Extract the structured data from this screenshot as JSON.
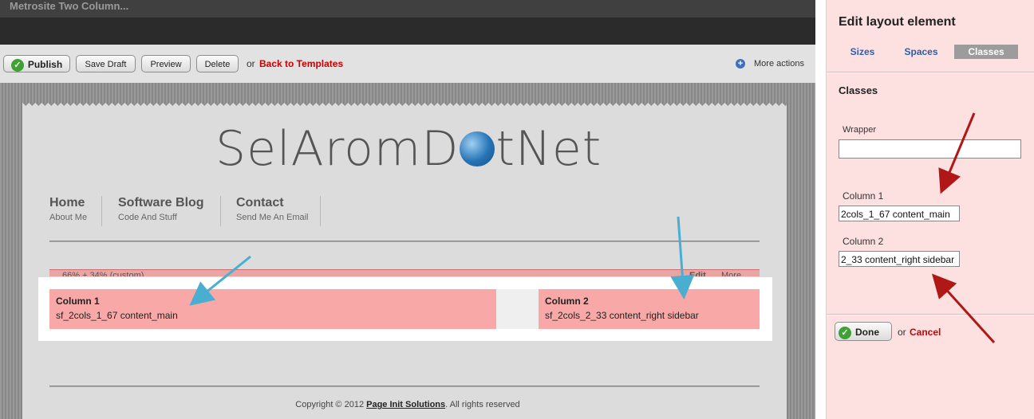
{
  "window": {
    "title": "Metrosite Two Column..."
  },
  "toolbar": {
    "publish_label": "Publish",
    "save_draft_label": "Save Draft",
    "preview_label": "Preview",
    "delete_label": "Delete",
    "or_text": "or",
    "back_link": "Back to Templates",
    "more_actions_label": "More actions"
  },
  "site": {
    "logo_text_left": "SelArom",
    "logo_text_mid": "D",
    "logo_text_right": "tNet",
    "nav": [
      {
        "title": "Home",
        "sub": "About Me"
      },
      {
        "title": "Software Blog",
        "sub": "Code And Stuff"
      },
      {
        "title": "Contact",
        "sub": "Send Me An Email"
      }
    ],
    "layout_bar_text": "66% + 34% (custom)",
    "layout_bar_edit": "Edit",
    "layout_bar_more": "More",
    "columns": [
      {
        "title": "Column 1",
        "classes": "sf_2cols_1_67 content_main"
      },
      {
        "title": "Column 2",
        "classes": "sf_2cols_2_33 content_right sidebar"
      }
    ],
    "copyright_prefix": "Copyright © 2012",
    "copyright_company": "Page Init Solutions",
    "copyright_suffix": ". All rights reserved"
  },
  "panel": {
    "title": "Edit layout element",
    "tabs": [
      "Sizes",
      "Spaces",
      "Classes"
    ],
    "active_tab": "Classes",
    "section_title": "Classes",
    "wrapper_label": "Wrapper",
    "wrapper_value": "",
    "column1_label": "Column 1",
    "column1_value": "2cols_1_67 content_main",
    "column2_label": "Column 2",
    "column2_value": "2_33 content_right sidebar",
    "done_label": "Done",
    "or_text": "or",
    "cancel_label": "Cancel"
  },
  "colors": {
    "accent_link": "#2a5db0",
    "danger_link": "#cc0000",
    "column_highlight": "#f9a8a8",
    "panel_bg": "#fde1e1",
    "arrow_blue": "#4aaed0",
    "arrow_red": "#b01818"
  }
}
